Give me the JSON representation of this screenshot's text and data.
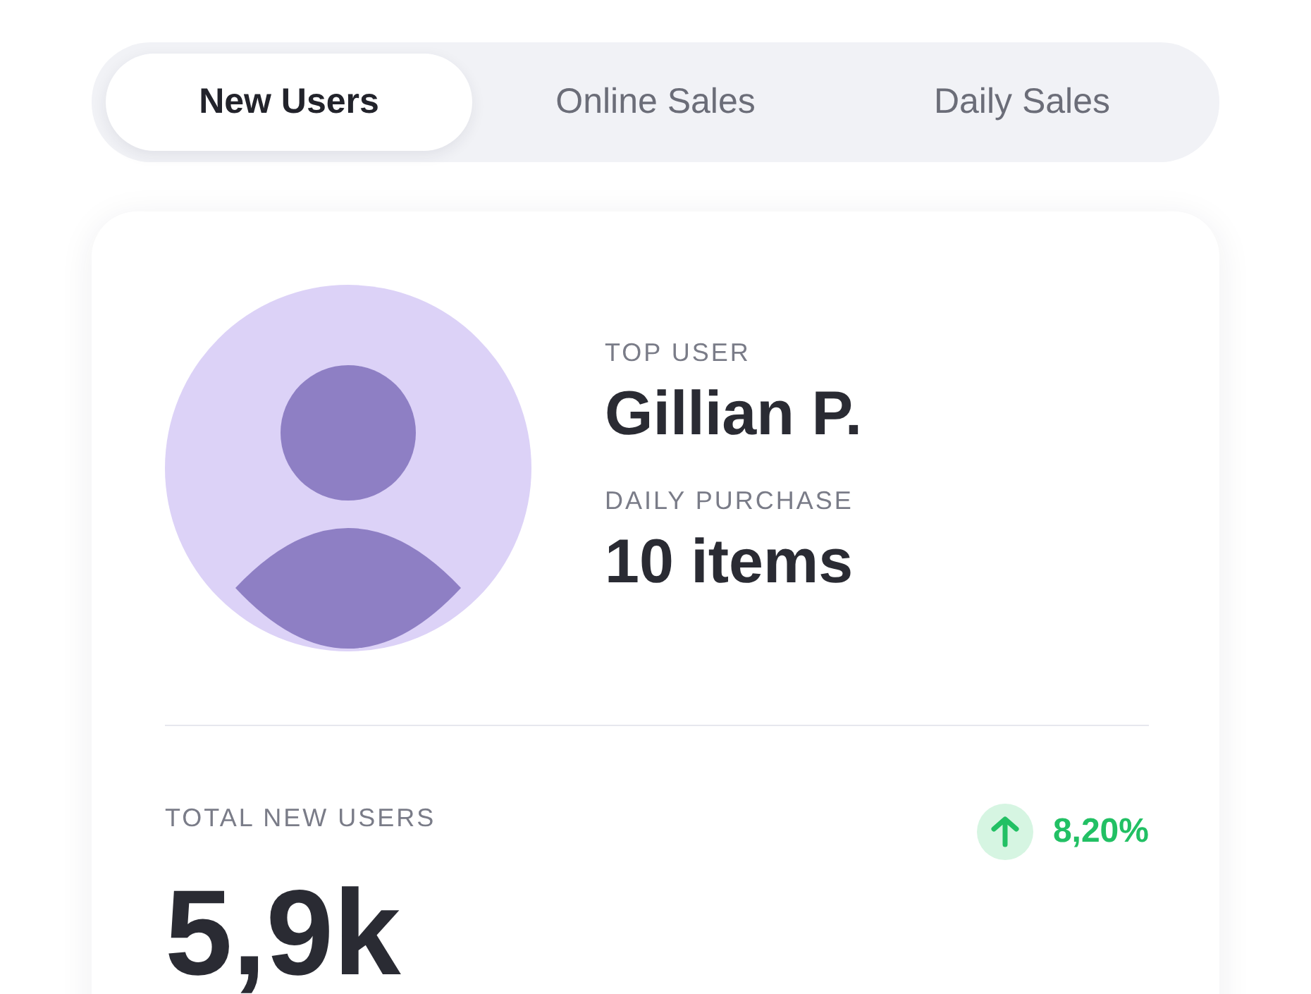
{
  "tabs": [
    {
      "label": "New Users",
      "selected": true
    },
    {
      "label": "Online Sales",
      "selected": false
    },
    {
      "label": "Daily Sales",
      "selected": false
    }
  ],
  "top_user": {
    "label": "TOP USER",
    "name": "Gillian P.",
    "purchase_label": "DAILY PURCHASE",
    "purchase": "10 items"
  },
  "total": {
    "label": "TOTAL NEW USERS",
    "value": "5,9k",
    "change": {
      "value": "8,20%",
      "kind": "up"
    }
  }
}
